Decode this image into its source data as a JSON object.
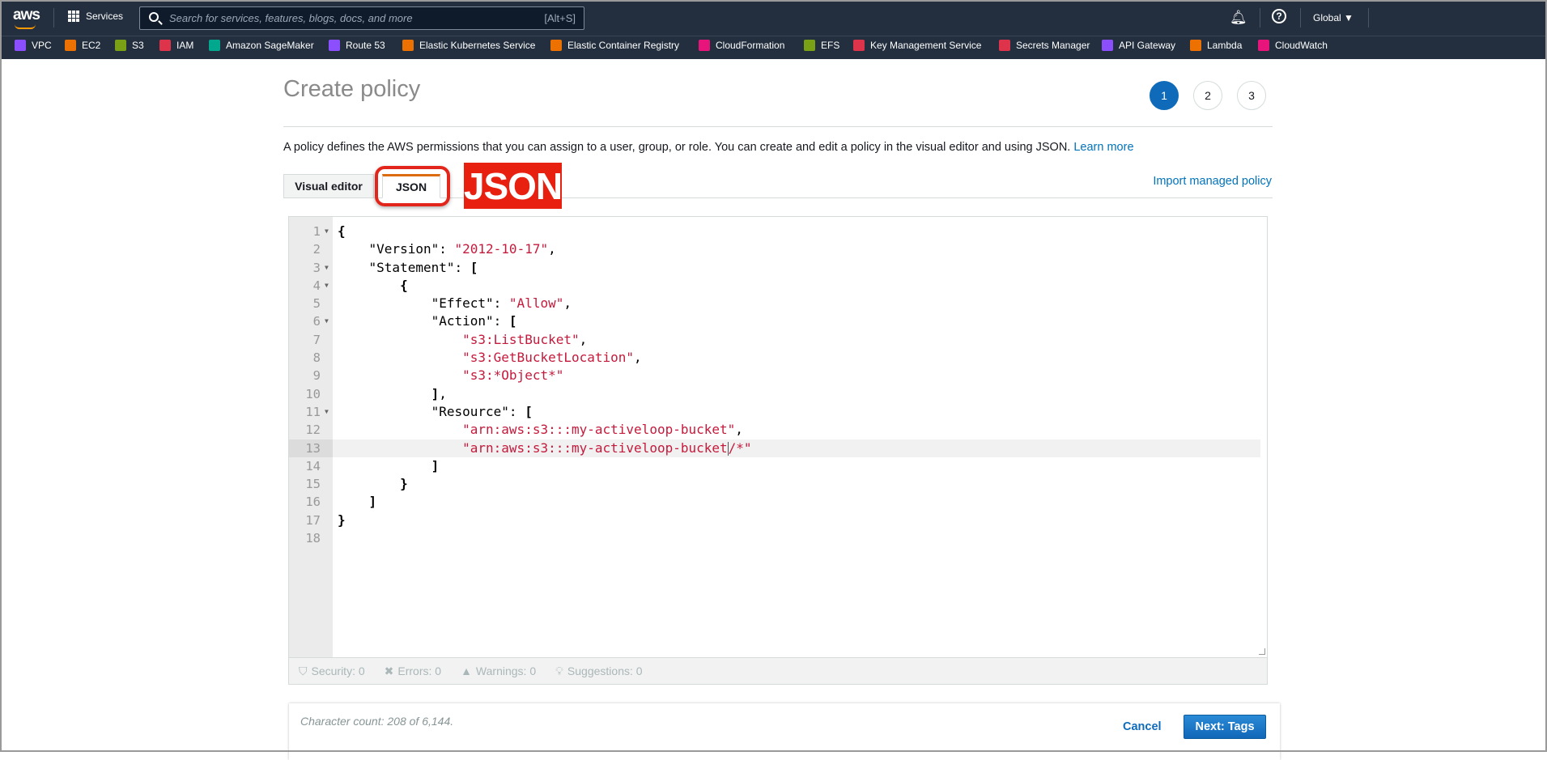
{
  "topnav": {
    "logo": "aws",
    "services_label": "Services",
    "search_placeholder": "Search for services, features, blogs, docs, and more",
    "search_shortcut": "[Alt+S]",
    "region": "Global ▼",
    "icons": [
      "bell-icon",
      "help-icon"
    ]
  },
  "favorites": [
    {
      "label": "VPC",
      "color": "#8c4fff"
    },
    {
      "label": "EC2",
      "color": "#ed7100"
    },
    {
      "label": "S3",
      "color": "#7aa116"
    },
    {
      "label": "IAM",
      "color": "#dd344c"
    },
    {
      "label": "Amazon SageMaker",
      "color": "#01a88d"
    },
    {
      "label": "Route 53",
      "color": "#8c4fff"
    },
    {
      "label": "Elastic Kubernetes Service",
      "color": "#ed7100"
    },
    {
      "label": "Elastic Container Registry",
      "color": "#ed7100"
    },
    {
      "label": "CloudFormation",
      "color": "#e7157b"
    },
    {
      "label": "EFS",
      "color": "#7aa116"
    },
    {
      "label": "Key Management Service",
      "color": "#dd344c"
    },
    {
      "label": "Secrets Manager",
      "color": "#dd344c"
    },
    {
      "label": "API Gateway",
      "color": "#8c4fff"
    },
    {
      "label": "Lambda",
      "color": "#ed7100"
    },
    {
      "label": "CloudWatch",
      "color": "#e7157b"
    }
  ],
  "page": {
    "title": "Create policy",
    "steps": [
      "1",
      "2",
      "3"
    ],
    "active_step": "1",
    "description": "A policy defines the AWS permissions that you can assign to a user, group, or role. You can create and edit a policy in the visual editor and using JSON. ",
    "learn_more": "Learn more",
    "tabs": [
      {
        "label": "Visual editor"
      },
      {
        "label": "JSON",
        "active": true
      }
    ],
    "annotation_label": "JSON",
    "import_link": "Import managed policy"
  },
  "editor": {
    "lines": [
      {
        "n": "1",
        "fold": true,
        "tokens": [
          {
            "t": "{",
            "c": "b"
          }
        ]
      },
      {
        "n": "2",
        "tokens": [
          {
            "t": "    \"Version\": ",
            "c": "p"
          },
          {
            "t": "\"2012-10-17\"",
            "c": "s"
          },
          {
            "t": ",",
            "c": "p"
          }
        ]
      },
      {
        "n": "3",
        "fold": true,
        "tokens": [
          {
            "t": "    \"Statement\": ",
            "c": "p"
          },
          {
            "t": "[",
            "c": "b"
          }
        ]
      },
      {
        "n": "4",
        "fold": true,
        "tokens": [
          {
            "t": "        {",
            "c": "b"
          }
        ]
      },
      {
        "n": "5",
        "tokens": [
          {
            "t": "            \"Effect\": ",
            "c": "p"
          },
          {
            "t": "\"Allow\"",
            "c": "s"
          },
          {
            "t": ",",
            "c": "p"
          }
        ]
      },
      {
        "n": "6",
        "fold": true,
        "tokens": [
          {
            "t": "            \"Action\": ",
            "c": "p"
          },
          {
            "t": "[",
            "c": "b"
          }
        ]
      },
      {
        "n": "7",
        "tokens": [
          {
            "t": "                \"s3:ListBucket\"",
            "c": "s"
          },
          {
            "t": ",",
            "c": "p"
          }
        ]
      },
      {
        "n": "8",
        "tokens": [
          {
            "t": "                \"s3:GetBucketLocation\"",
            "c": "s"
          },
          {
            "t": ",",
            "c": "p"
          }
        ]
      },
      {
        "n": "9",
        "tokens": [
          {
            "t": "                \"s3:*Object*\"",
            "c": "s"
          }
        ]
      },
      {
        "n": "10",
        "tokens": [
          {
            "t": "            ]",
            "c": "b"
          },
          {
            "t": ",",
            "c": "p"
          }
        ]
      },
      {
        "n": "11",
        "fold": true,
        "tokens": [
          {
            "t": "            \"Resource\": ",
            "c": "p"
          },
          {
            "t": "[",
            "c": "b"
          }
        ]
      },
      {
        "n": "12",
        "tokens": [
          {
            "t": "                \"arn:aws:s3:::my-activeloop-bucket\"",
            "c": "s"
          },
          {
            "t": ",",
            "c": "p"
          }
        ]
      },
      {
        "n": "13",
        "active": true,
        "tokens": [
          {
            "t": "                \"arn:aws:s3:::my-activeloop-bucket",
            "c": "s"
          },
          {
            "t": "/*\"",
            "c": "s",
            "cursor": true
          }
        ]
      },
      {
        "n": "14",
        "tokens": [
          {
            "t": "            ]",
            "c": "b"
          }
        ]
      },
      {
        "n": "15",
        "tokens": [
          {
            "t": "        }",
            "c": "b"
          }
        ]
      },
      {
        "n": "16",
        "tokens": [
          {
            "t": "    ]",
            "c": "b"
          }
        ]
      },
      {
        "n": "17",
        "tokens": [
          {
            "t": "}",
            "c": "b"
          }
        ]
      },
      {
        "n": "18",
        "tokens": []
      }
    ],
    "status": {
      "security": "Security: 0",
      "errors": "Errors: 0",
      "warnings": "Warnings: 0",
      "suggestions": "Suggestions: 0"
    }
  },
  "footer": {
    "char_count": "Character count: 208 of 6,144.",
    "cancel": "Cancel",
    "next": "Next: Tags"
  }
}
